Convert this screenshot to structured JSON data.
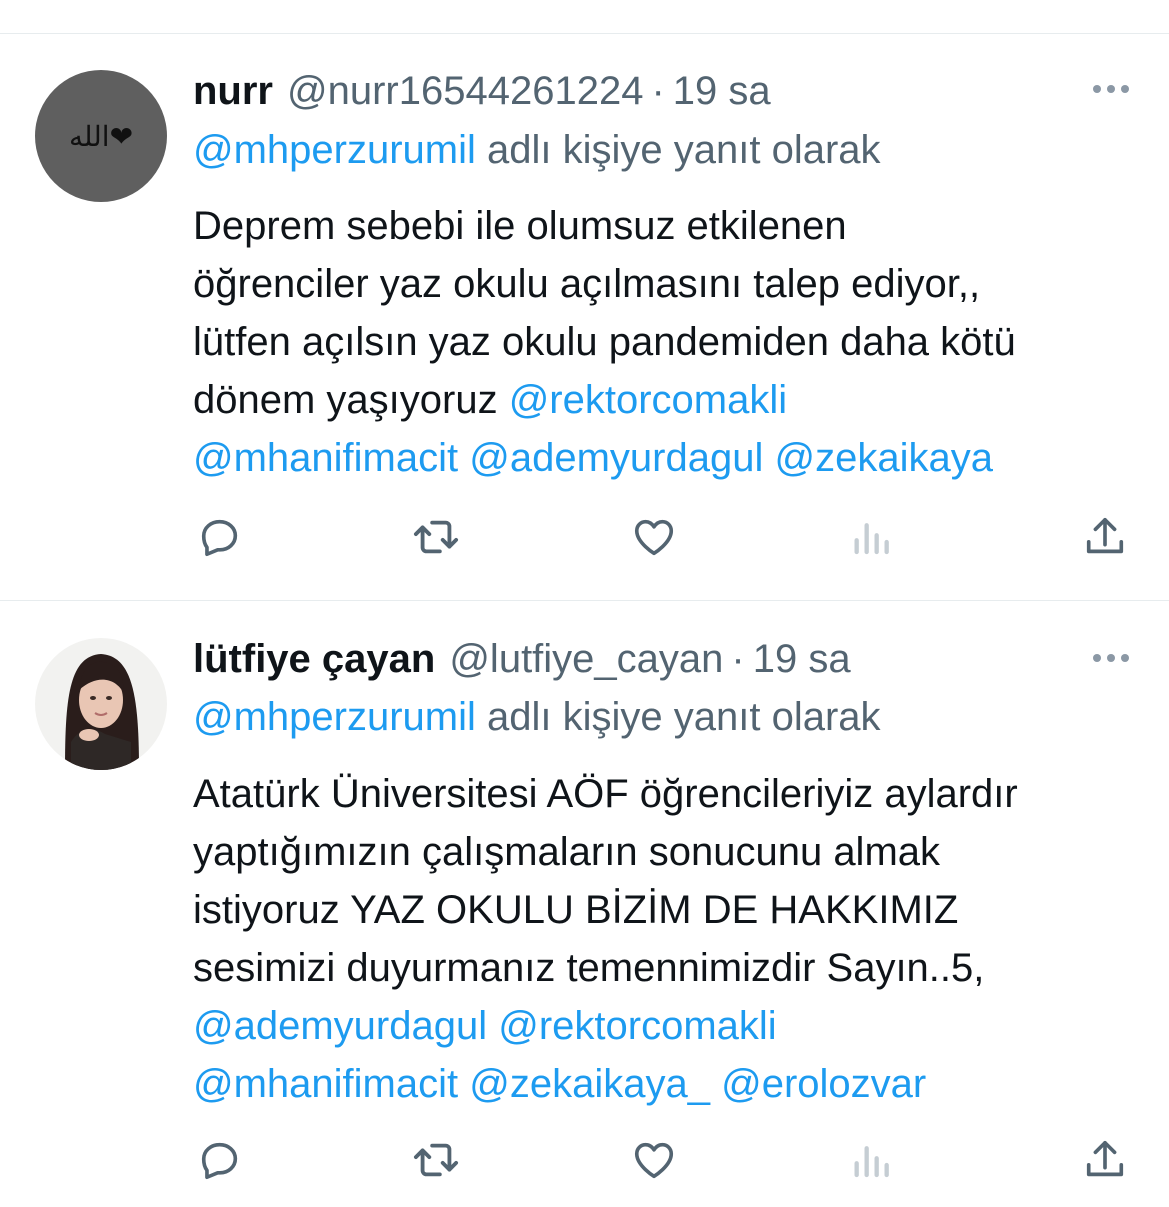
{
  "tweets": [
    {
      "name": "nurr",
      "handle": "@nurr16544261224",
      "separator": "·",
      "time": "19 sa",
      "avatar_text": "الله❤",
      "reply_to": "@mhperzurumil",
      "reply_suffix": "adlı kişiye yanıt olarak",
      "text_lines": [
        "Deprem sebebi ile olumsuz etkilenen",
        "öğrenciler yaz okulu açılmasını talep ediyor,,",
        "lütfen açılsın yaz okulu pandemiden daha kötü"
      ],
      "text_line4_prefix": "dönem yaşıyoruz ",
      "mentions": [
        "@rektorcomakli",
        "@mhanifimacit",
        "@ademyurdagul",
        "@zekaikaya"
      ]
    },
    {
      "name": "lütfiye çayan",
      "handle": "@lutfiye_cayan",
      "separator": "·",
      "time": "19 sa",
      "reply_to": "@mhperzurumil",
      "reply_suffix": "adlı kişiye yanıt olarak",
      "text_lines": [
        "Atatürk Üniversitesi AÖF öğrencileriyiz aylardır",
        "yaptığımızın çalışmaların sonucunu almak",
        "istiyoruz YAZ OKULU BİZİM DE HAKKIMIZ",
        "sesimizi duyurmanız temennimizdir Sayın..5,"
      ],
      "mentions": [
        "@ademyurdagul",
        "@rektorcomakli",
        "@mhanifimacit",
        "@zekaikaya_",
        "@erolozvar"
      ]
    }
  ],
  "icons": {
    "reply": "reply-icon",
    "retweet": "retweet-icon",
    "like": "heart-icon",
    "views": "views-icon",
    "share": "share-icon",
    "more": "more-icon"
  },
  "colors": {
    "link": "#1d9bf0",
    "secondary_text": "#536471",
    "primary_text": "#0f1419",
    "icon": "#536471",
    "divider": "#e7ecee"
  }
}
